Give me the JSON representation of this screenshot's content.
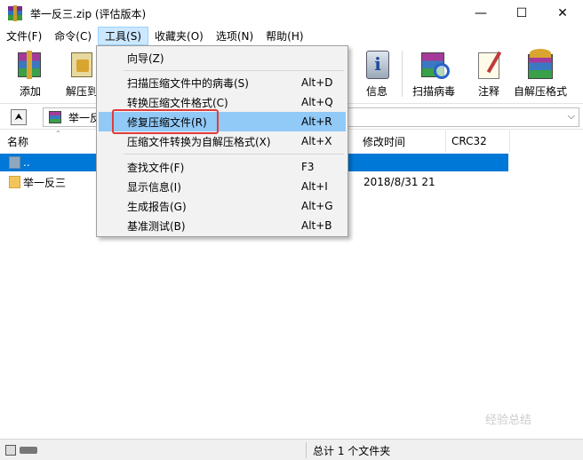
{
  "window": {
    "title": "举一反三.zip (评估版本)",
    "minimize": "—",
    "maximize": "☐",
    "close": "✕"
  },
  "menubar": [
    {
      "label": "文件(F)"
    },
    {
      "label": "命令(C)"
    },
    {
      "label": "工具(S)"
    },
    {
      "label": "收藏夹(O)"
    },
    {
      "label": "选项(N)"
    },
    {
      "label": "帮助(H)"
    }
  ],
  "toolbar": [
    {
      "label": "添加",
      "icon": "add-archive-icon"
    },
    {
      "label": "解压到",
      "icon": "extract-icon"
    },
    {
      "label": "信息",
      "icon": "info-icon"
    },
    {
      "label": "扫描病毒",
      "icon": "scan-virus-icon"
    },
    {
      "label": "注释",
      "icon": "comment-icon"
    },
    {
      "label": "自解压格式",
      "icon": "sfx-icon"
    }
  ],
  "address": {
    "path": "举一反"
  },
  "columns": {
    "name": "名称",
    "modified": "修改时间",
    "crc": "CRC32"
  },
  "files": [
    {
      "name": "..",
      "modified": "",
      "selected": true
    },
    {
      "name": "举一反三",
      "modified": "2018/8/31 21",
      "selected": false
    }
  ],
  "tools_menu": {
    "items": [
      {
        "label": "向导(Z)",
        "shortcut": ""
      },
      {
        "label": "扫描压缩文件中的病毒(S)",
        "shortcut": "Alt+D"
      },
      {
        "label": "转换压缩文件格式(C)",
        "shortcut": "Alt+Q"
      },
      {
        "label": "修复压缩文件(R)",
        "shortcut": "Alt+R"
      },
      {
        "label": "压缩文件转换为自解压格式(X)",
        "shortcut": "Alt+X"
      },
      {
        "label": "查找文件(F)",
        "shortcut": "F3"
      },
      {
        "label": "显示信息(I)",
        "shortcut": "Alt+I"
      },
      {
        "label": "生成报告(G)",
        "shortcut": "Alt+G"
      },
      {
        "label": "基准测试(B)",
        "shortcut": "Alt+B"
      }
    ]
  },
  "status": {
    "text": "总计 1 个文件夹"
  },
  "watermark": "经验总结"
}
